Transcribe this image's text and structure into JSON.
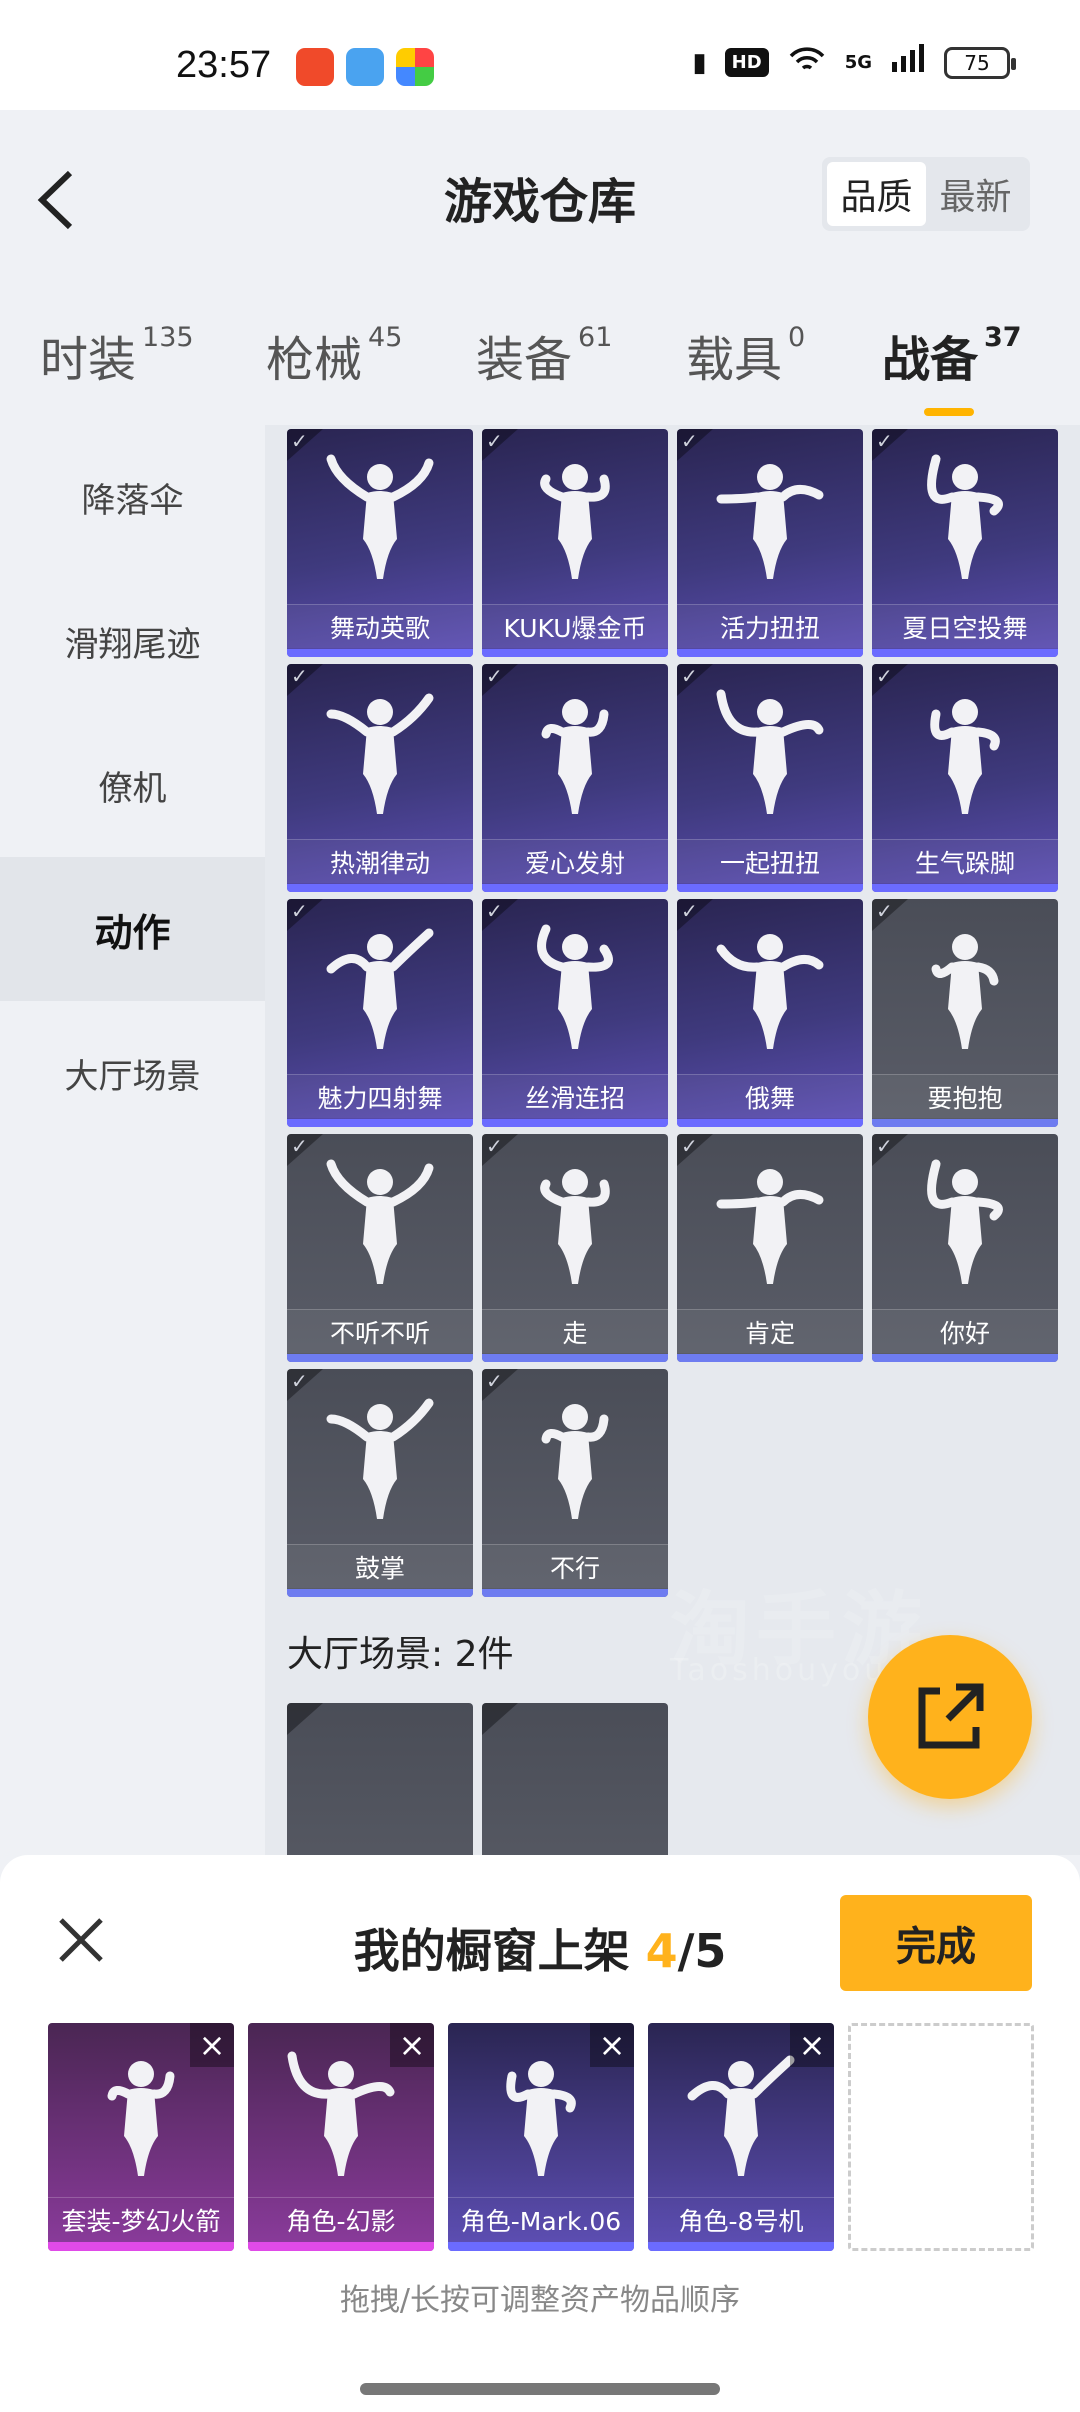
{
  "status": {
    "time": "23:57",
    "hd": "HD",
    "network": "5G",
    "battery": "75"
  },
  "header": {
    "title": "游戏仓库",
    "sort_options": [
      "品质",
      "最新"
    ]
  },
  "tabs": [
    {
      "label": "时装",
      "count": "135"
    },
    {
      "label": "枪械",
      "count": "45"
    },
    {
      "label": "装备",
      "count": "61"
    },
    {
      "label": "载具",
      "count": "0"
    },
    {
      "label": "战备",
      "count": "37"
    }
  ],
  "sidebar": [
    "降落伞",
    "滑翔尾迹",
    "僚机",
    "动作",
    "大厅场景"
  ],
  "cards": [
    {
      "label": "舞动英歌",
      "style": "purple"
    },
    {
      "label": "KUKU爆金币",
      "style": "purple"
    },
    {
      "label": "活力扭扭",
      "style": "purple"
    },
    {
      "label": "夏日空投舞",
      "style": "purple"
    },
    {
      "label": "热潮律动",
      "style": "purple"
    },
    {
      "label": "爱心发射",
      "style": "purple"
    },
    {
      "label": "一起扭扭",
      "style": "purple"
    },
    {
      "label": "生气跺脚",
      "style": "purple"
    },
    {
      "label": "魅力四射舞",
      "style": "purple"
    },
    {
      "label": "丝滑连招",
      "style": "purple"
    },
    {
      "label": "俄舞",
      "style": "purple"
    },
    {
      "label": "要抱抱",
      "style": "gray"
    },
    {
      "label": "不听不听",
      "style": "gray"
    },
    {
      "label": "走",
      "style": "gray"
    },
    {
      "label": "肯定",
      "style": "gray"
    },
    {
      "label": "你好",
      "style": "gray"
    },
    {
      "label": "鼓掌",
      "style": "gray"
    },
    {
      "label": "不行",
      "style": "gray"
    }
  ],
  "section_label": "大厅场景: 2件",
  "watermark": {
    "cn": "淘手游",
    "en": "Taoshouyou.com"
  },
  "bottom": {
    "title_prefix": "我的橱窗上架 ",
    "count": "4",
    "total": "/5",
    "done": "完成",
    "slots": [
      {
        "label": "套装-梦幻火箭",
        "style": "pink"
      },
      {
        "label": "角色-幻影",
        "style": "pink"
      },
      {
        "label": "角色-Mark.06",
        "style": "purple"
      },
      {
        "label": "角色-8号机",
        "style": "purple"
      }
    ],
    "hint": "拖拽/长按可调整资产物品顺序"
  },
  "colors": {
    "accent": "#ffb21c",
    "purple_bar": "#6b6bff",
    "pink_bar": "#e04ae8"
  }
}
